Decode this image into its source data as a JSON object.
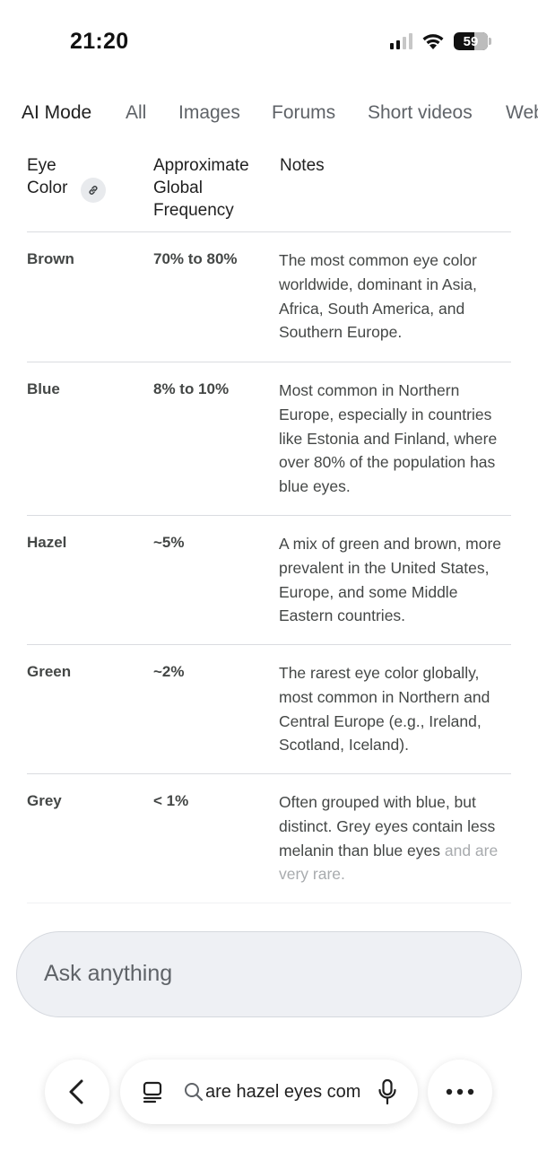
{
  "status_bar": {
    "time": "21:20",
    "battery_level": "59"
  },
  "tabs": [
    {
      "label": "AI Mode",
      "active": true
    },
    {
      "label": "All"
    },
    {
      "label": "Images"
    },
    {
      "label": "Forums"
    },
    {
      "label": "Short videos"
    },
    {
      "label": "Web"
    }
  ],
  "table": {
    "headers": {
      "eye_color": "Eye Color",
      "frequency": "Approximate Global Frequency",
      "notes": "Notes"
    },
    "rows": [
      {
        "color": "Brown",
        "frequency": "70% to 80%",
        "notes": "The most common eye color worldwide, dominant in Asia, Africa, South America, and Southern Europe."
      },
      {
        "color": "Blue",
        "frequency": "8% to 10%",
        "notes": "Most common in Northern Europe, especially in countries like Estonia and Finland, where over 80% of the population has blue eyes."
      },
      {
        "color": "Hazel",
        "frequency": "~5%",
        "notes": "A mix of green and brown, more prevalent in the United States, Europe, and some Middle Eastern countries."
      },
      {
        "color": "Green",
        "frequency": "~2%",
        "notes": "The rarest eye color globally, most common in Northern and Central Europe (e.g., Ireland, Scotland, Iceland)."
      },
      {
        "color": "Grey",
        "frequency": "< 1%",
        "notes": "Often grouped with blue, but distinct. Grey eyes contain less melanin than blue eyes",
        "notes_faded": "and are very rare."
      }
    ]
  },
  "ask": {
    "placeholder": "Ask anything"
  },
  "bottom_bar": {
    "query": "are hazel eyes common"
  },
  "icons": {
    "link": "link-icon",
    "back": "chevron-left-icon",
    "tabs": "tabs-icon",
    "search": "search-icon",
    "mic": "mic-icon",
    "more": "more-horizontal-icon"
  }
}
